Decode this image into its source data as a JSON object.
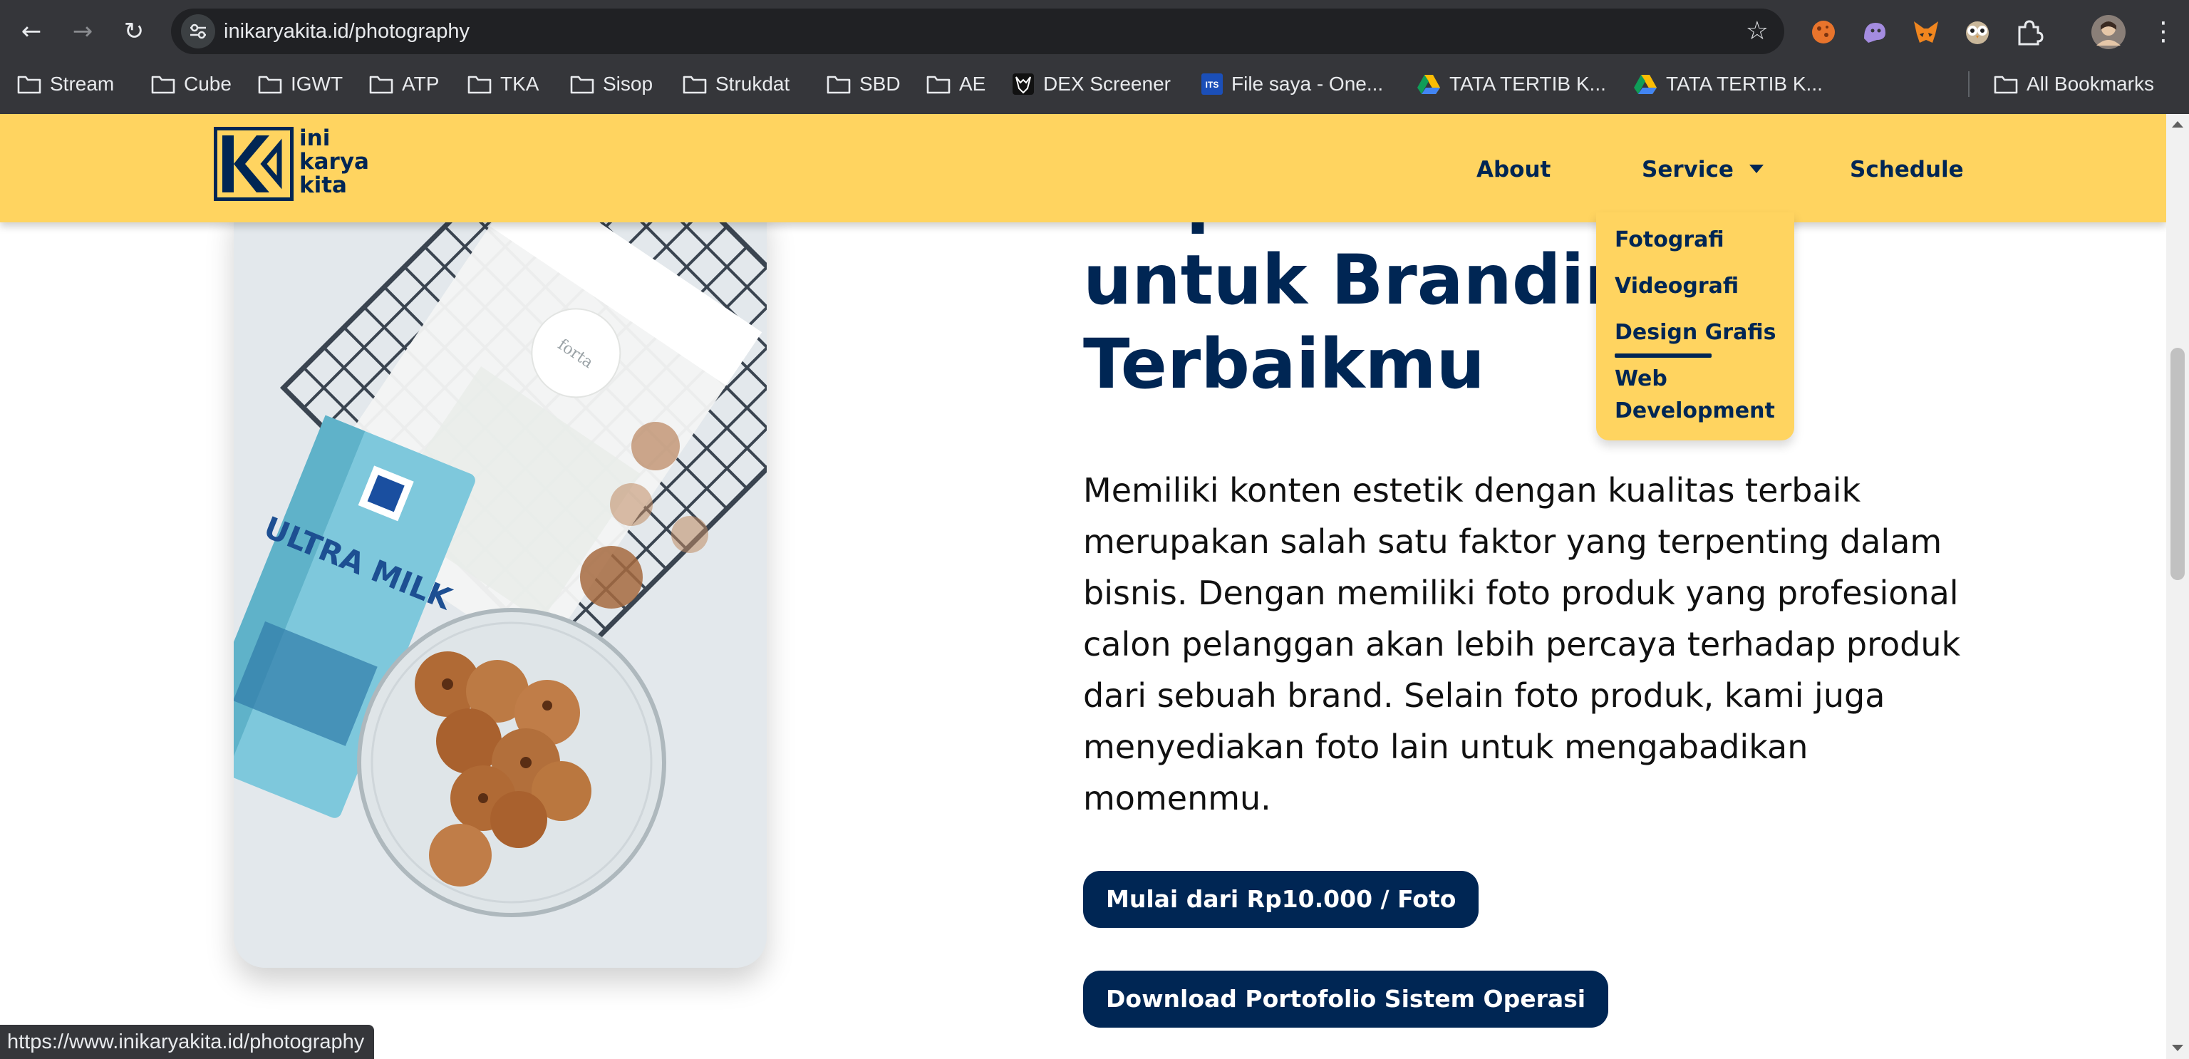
{
  "browser": {
    "url": "inikaryakita.id/photography",
    "bookmarks": [
      {
        "label": "Stream",
        "icon": "folder-icon"
      },
      {
        "label": "Cube",
        "icon": "folder-icon"
      },
      {
        "label": "IGWT",
        "icon": "folder-icon"
      },
      {
        "label": "ATP",
        "icon": "folder-icon"
      },
      {
        "label": "TKA",
        "icon": "folder-icon"
      },
      {
        "label": "Sisop",
        "icon": "folder-icon"
      },
      {
        "label": "Strukdat",
        "icon": "folder-icon"
      },
      {
        "label": "SBD",
        "icon": "folder-icon"
      },
      {
        "label": "AE",
        "icon": "folder-icon"
      },
      {
        "label": "DEX Screener",
        "icon": "dex-screener-icon"
      },
      {
        "label": "File saya - One...",
        "icon": "its-icon"
      },
      {
        "label": "TATA TERTIB K...",
        "icon": "google-drive-icon"
      },
      {
        "label": "TATA TERTIB K...",
        "icon": "google-drive-icon"
      }
    ],
    "all_bookmarks": "All Bookmarks",
    "status_url": "https://www.inikaryakita.id/photography"
  },
  "site": {
    "logo_lines": [
      "ini",
      "karya",
      "kita"
    ],
    "nav": {
      "about": "About",
      "service": "Service",
      "schedule": "Schedule"
    },
    "dropdown": [
      "Fotografi",
      "Videografi",
      "Design Grafis",
      "Web Development"
    ],
    "headline": [
      "Dapatkan Foto Terbaik",
      "untuk Branding",
      "Terbaikmu"
    ],
    "body": "Memiliki konten estetik dengan kualitas terbaik merupakan salah satu faktor yang terpenting dalam bisnis. Dengan memiliki foto produk yang profesional calon pelanggan akan lebih percaya terhadap produk dari sebuah brand. Selain foto produk, kami juga menyediakan foto lain untuk mengabadikan momenmu.",
    "cta_price": "Mulai dari Rp10.000 / Foto",
    "cta_download": "Download Portofolio Sistem Operasi",
    "photo": {
      "milk_text": "ULTRA MILK",
      "bag_text": "forta"
    }
  },
  "colors": {
    "brand_navy": "#002654",
    "brand_yellow": "#ffd460",
    "chrome_dark": "#35363a"
  }
}
